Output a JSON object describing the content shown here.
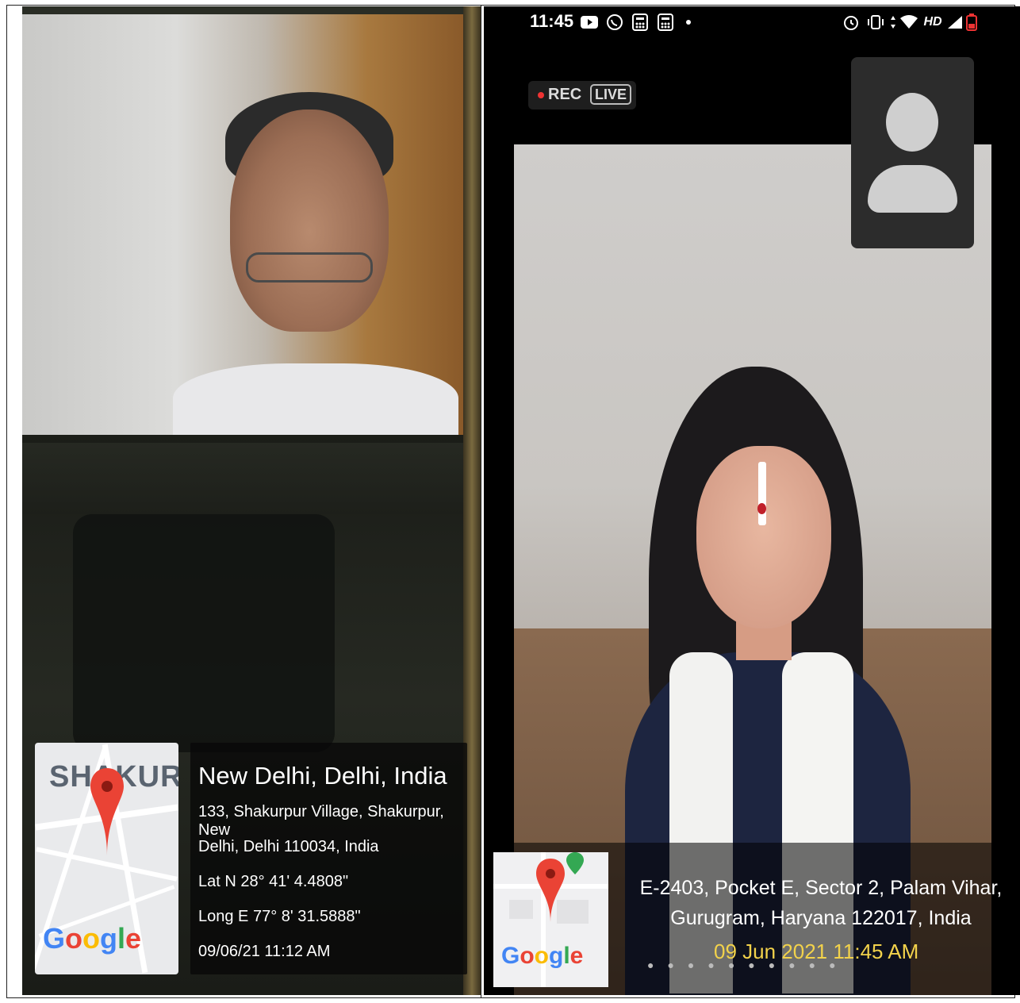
{
  "left_panel": {
    "map": {
      "area_label": "SHAKURPUR",
      "brand": [
        "G",
        "o",
        "o",
        "g",
        "l",
        "e"
      ]
    },
    "info": {
      "title": "New Delhi, Delhi, India",
      "address_line_1": "133, Shakurpur Village, Shakurpur, New",
      "address_line_2": "Delhi, Delhi 110034, India",
      "latitude": "Lat N 28° 41' 4.4808\"",
      "longitude": "Long E 77° 8' 31.5888\"",
      "datetime": "09/06/21 11:12 AM"
    }
  },
  "right_panel": {
    "status_bar": {
      "time": "11:45",
      "network_label": "HD"
    },
    "recording": {
      "rec_label": "REC",
      "live_label": "LIVE"
    },
    "geo": {
      "brand": [
        "G",
        "o",
        "o",
        "g",
        "l",
        "e"
      ],
      "address_line_1": "E-2403, Pocket E, Sector 2, Palam Vihar,",
      "address_line_2": "Gurugram, Haryana 122017, India",
      "datetime": "09 Jun 2021 11:45 AM"
    }
  },
  "colors": {
    "pin_red": "#ea4335",
    "date_yellow": "#f2d24b",
    "rec_red": "#e33333"
  }
}
